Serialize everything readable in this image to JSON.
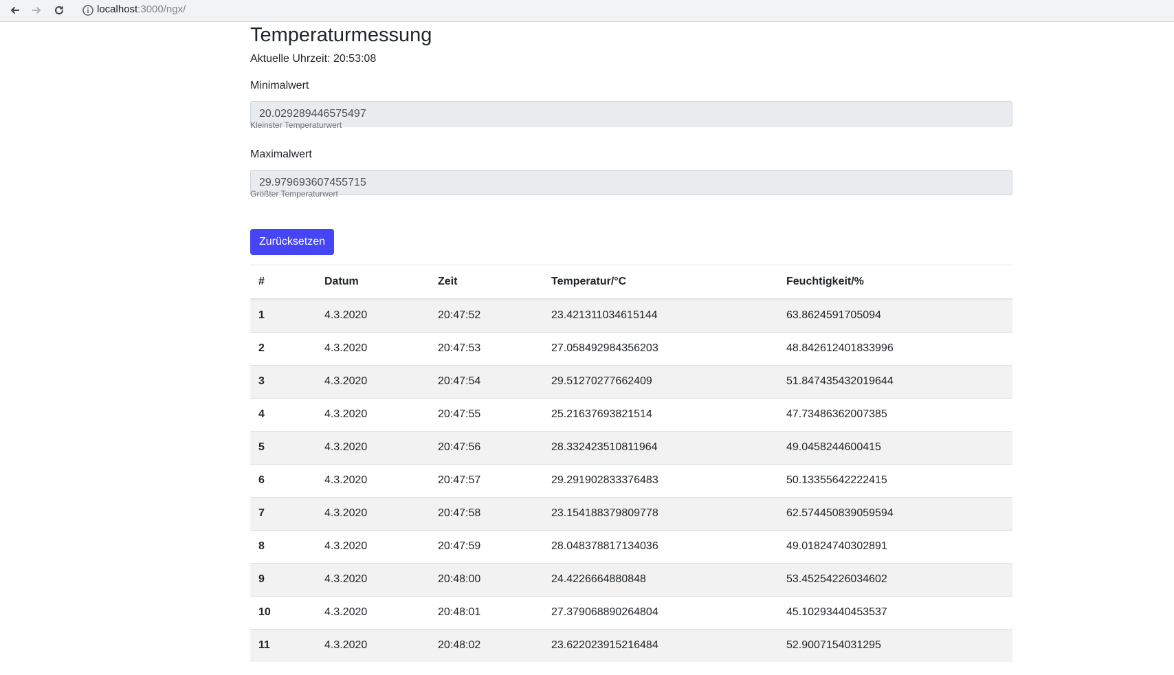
{
  "browser": {
    "url_host": "localhost",
    "url_rest": ":3000/ngx/"
  },
  "page": {
    "title": "Temperaturmessung",
    "clock": "Aktuelle Uhrzeit: 20:53:08",
    "min": {
      "label": "Minimalwert",
      "value": "20.029289446575497",
      "help": "Kleinster Temperaturwert"
    },
    "max": {
      "label": "Maximalwert",
      "value": "29.979693607455715",
      "help": "Größter Temperaturwert"
    },
    "reset_label": "Zurücksetzen"
  },
  "table": {
    "headers": [
      "#",
      "Datum",
      "Zeit",
      "Temperatur/°C",
      "Feuchtigkeit/%"
    ],
    "rows": [
      [
        "1",
        "4.3.2020",
        "20:47:52",
        "23.421311034615144",
        "63.8624591705094"
      ],
      [
        "2",
        "4.3.2020",
        "20:47:53",
        "27.058492984356203",
        "48.842612401833996"
      ],
      [
        "3",
        "4.3.2020",
        "20:47:54",
        "29.51270277662409",
        "51.847435432019644"
      ],
      [
        "4",
        "4.3.2020",
        "20:47:55",
        "25.21637693821514",
        "47.73486362007385"
      ],
      [
        "5",
        "4.3.2020",
        "20:47:56",
        "28.332423510811964",
        "49.0458244600415"
      ],
      [
        "6",
        "4.3.2020",
        "20:47:57",
        "29.291902833376483",
        "50.13355642222415"
      ],
      [
        "7",
        "4.3.2020",
        "20:47:58",
        "23.154188379809778",
        "62.574450839059594"
      ],
      [
        "8",
        "4.3.2020",
        "20:47:59",
        "28.048378817134036",
        "49.01824740302891"
      ],
      [
        "9",
        "4.3.2020",
        "20:48:00",
        "24.4226664880848",
        "53.45254226034602"
      ],
      [
        "10",
        "4.3.2020",
        "20:48:01",
        "27.379068890264804",
        "45.10293440453537"
      ],
      [
        "11",
        "4.3.2020",
        "20:48:02",
        "23.622023915216484",
        "52.9007154031295"
      ]
    ]
  }
}
